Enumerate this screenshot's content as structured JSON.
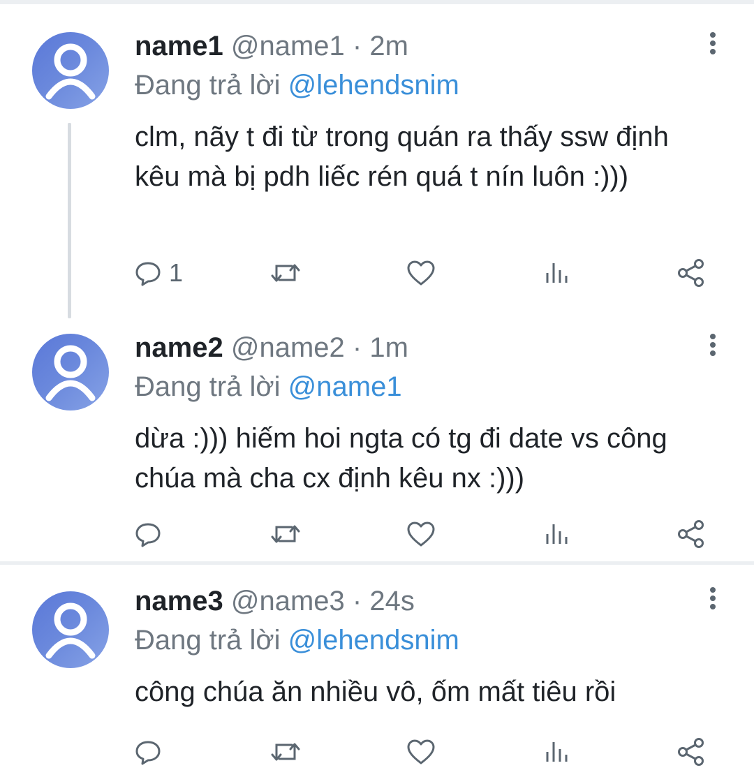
{
  "tweets": [
    {
      "name": "name1",
      "handle": "@name1",
      "separator": "·",
      "time": "2m",
      "reply_prefix": "Đang trả lời",
      "reply_to": "@lehendsnim",
      "text": "clm, nãy t đi từ trong quán ra thấy ssw định kêu mà bị pdh liếc rén quá t nín luôn :)))",
      "reply_count": "1"
    },
    {
      "name": "name2",
      "handle": "@name2",
      "separator": "·",
      "time": "1m",
      "reply_prefix": "Đang trả lời",
      "reply_to": "@name1",
      "text": "dừa :))) hiếm hoi ngta có tg đi date vs công chúa mà cha cx định kêu nx :)))",
      "reply_count": ""
    },
    {
      "name": "name3",
      "handle": "@name3",
      "separator": "·",
      "time": "24s",
      "reply_prefix": "Đang trả lời",
      "reply_to": "@lehendsnim",
      "text": "công chúa ăn nhiều vô, ốm mất tiêu rồi",
      "reply_count": ""
    }
  ],
  "icons": {
    "avatar": "default-avatar-icon",
    "reply": "reply-icon",
    "retweet": "retweet-icon",
    "like": "heart-icon",
    "analytics": "analytics-icon",
    "share": "share-icon",
    "more": "more-vertical-icon"
  },
  "colors": {
    "mention": "#3a8fd9",
    "avatar": "#6a88dc",
    "secondary_text": "#6e7780"
  }
}
